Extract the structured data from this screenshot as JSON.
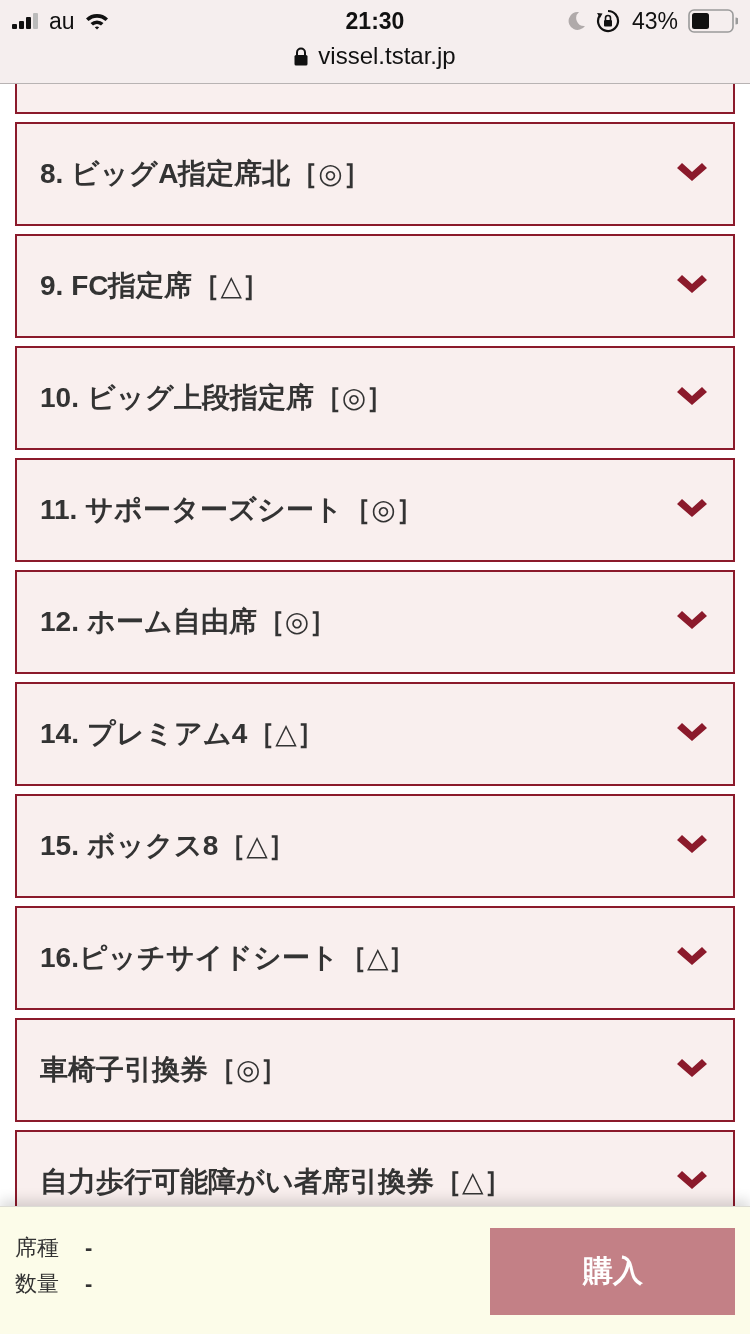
{
  "status_bar": {
    "carrier": "au",
    "time": "21:30",
    "battery": "43%"
  },
  "address_bar": {
    "url": "vissel.tstar.jp"
  },
  "seat_sections": [
    {
      "label": "8. ビッグA指定席北［◎］",
      "expanded": false
    },
    {
      "label": "9. FC指定席［△］",
      "expanded": false
    },
    {
      "label": "10. ビッグ上段指定席［◎］",
      "expanded": false
    },
    {
      "label": "11. サポーターズシート［◎］",
      "expanded": false
    },
    {
      "label": "12. ホーム自由席［◎］",
      "expanded": false
    },
    {
      "label": "14. プレミアム4［△］",
      "expanded": false
    },
    {
      "label": "15. ボックス8［△］",
      "expanded": false
    },
    {
      "label": "16.ピッチサイドシート［△］",
      "expanded": false
    },
    {
      "label": "車椅子引換券［◎］",
      "expanded": false
    },
    {
      "label": "自力歩行可能障がい者席引換券［△］",
      "expanded": false
    }
  ],
  "footer": {
    "summary": [
      {
        "label": "席種",
        "value": "-"
      },
      {
        "label": "数量",
        "value": "-"
      }
    ],
    "buy_button": {
      "label": "購入",
      "disabled": true
    }
  }
}
